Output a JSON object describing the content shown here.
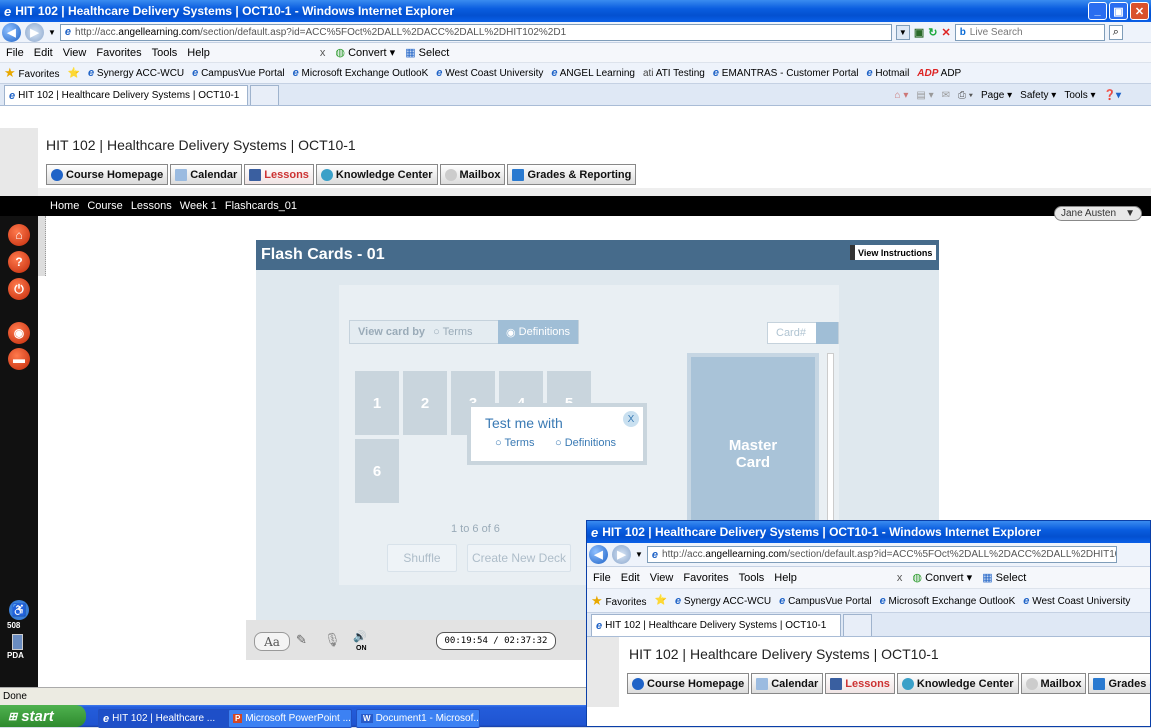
{
  "window": {
    "title": "HIT 102 | Healthcare Delivery Systems | OCT10-1 - Windows Internet Explorer"
  },
  "address": {
    "url_prefix": "http://acc.",
    "url_domain": "angellearning.com",
    "url_path": "/section/default.asp?id=ACC%5FOct%2DALL%2DACC%2DALL%2DHIT102%2D1",
    "search_placeholder": "Live Search"
  },
  "menu": [
    "File",
    "Edit",
    "View",
    "Favorites",
    "Tools",
    "Help"
  ],
  "convert": {
    "close": "x",
    "convert": "Convert",
    "select": "Select"
  },
  "favorites": {
    "label": "Favorites",
    "links": [
      "Synergy ACC-WCU",
      "CampusVue Portal",
      "Microsoft Exchange OutlooK",
      "West Coast University",
      "ANGEL Learning",
      "ATI Testing",
      "EMANTRAS - Customer Portal",
      "Hotmail",
      "ADP"
    ]
  },
  "tabs": {
    "current": "HIT 102 | Healthcare Delivery Systems | OCT10-1"
  },
  "commandbar": [
    "Page",
    "Safety",
    "Tools"
  ],
  "course": {
    "title": "HIT 102 | Healthcare Delivery Systems | OCT10-1",
    "nav": [
      "Course Homepage",
      "Calendar",
      "Lessons",
      "Knowledge Center",
      "Mailbox",
      "Grades & Reporting"
    ],
    "breadcrumb": [
      "Home",
      "Course",
      "Lessons",
      "Week 1",
      "Flashcards_01"
    ],
    "user": "Jane Austen"
  },
  "flashcards": {
    "title": "Flash Cards - 01",
    "view_instructions": "View Instructions",
    "view_card_by": "View card by",
    "terms": "Terms",
    "definitions": "Definitions",
    "card_num": "Card#",
    "cards": [
      "1",
      "2",
      "3",
      "4",
      "5",
      "6"
    ],
    "test_me_with": "Test me with",
    "close": "X",
    "master_card_1": "Master",
    "master_card_2": "Card",
    "count": "1 to 6 of 6",
    "shuffle": "Shuffle",
    "create_new_deck": "Create New Deck",
    "timer": "00:19:54 / 02:37:32",
    "font_btn": "Aa",
    "audio_on": "ON"
  },
  "leftbar": {
    "accessibility": "508",
    "pda": "PDA"
  },
  "status": {
    "text": "Done"
  },
  "taskbar": {
    "start": "start",
    "items": [
      "HIT 102 | Healthcare ...",
      "Microsoft PowerPoint ...",
      "Document1 - Microsof..."
    ]
  },
  "colors": {
    "xp_blue": "#0a5ddf",
    "flash_header": "#466b8b",
    "active_tab": "#cc3333"
  }
}
